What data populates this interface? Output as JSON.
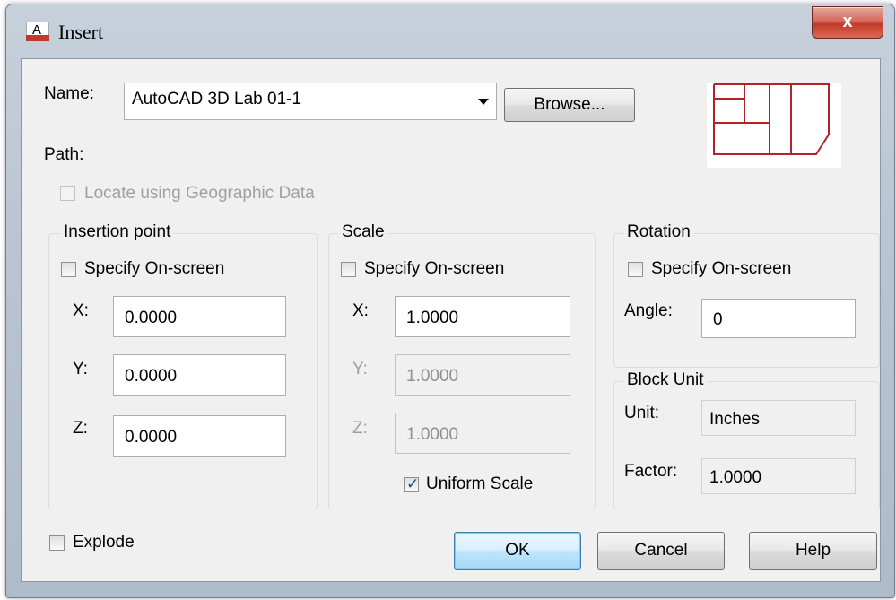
{
  "window": {
    "title": "Insert",
    "app_icon_letter": "A",
    "close_label": "x"
  },
  "name_row": {
    "label": "Name:",
    "value": "AutoCAD 3D Lab 01-1",
    "browse_label": "Browse..."
  },
  "path_label": "Path:",
  "geo": {
    "label": "Locate using Geographic Data",
    "checked": false,
    "enabled": false
  },
  "insertion_point": {
    "title": "Insertion point",
    "specify_label": "Specify On-screen",
    "x_label": "X:",
    "x_value": "0.0000",
    "y_label": "Y:",
    "y_value": "0.0000",
    "z_label": "Z:",
    "z_value": "0.0000"
  },
  "scale": {
    "title": "Scale",
    "specify_label": "Specify On-screen",
    "x_label": "X:",
    "x_value": "1.0000",
    "y_label": "Y:",
    "y_value": "1.0000",
    "z_label": "Z:",
    "z_value": "1.0000",
    "uniform_label": "Uniform Scale",
    "uniform_checked": true
  },
  "rotation": {
    "title": "Rotation",
    "specify_label": "Specify On-screen",
    "angle_label": "Angle:",
    "angle_value": "0"
  },
  "block_unit": {
    "title": "Block Unit",
    "unit_label": "Unit:",
    "unit_value": "Inches",
    "factor_label": "Factor:",
    "factor_value": "1.0000"
  },
  "explode_label": "Explode",
  "buttons": {
    "ok": "OK",
    "cancel": "Cancel",
    "help": "Help"
  },
  "colors": {
    "accent_red": "#c0392b",
    "preview_line": "#b3242a"
  }
}
